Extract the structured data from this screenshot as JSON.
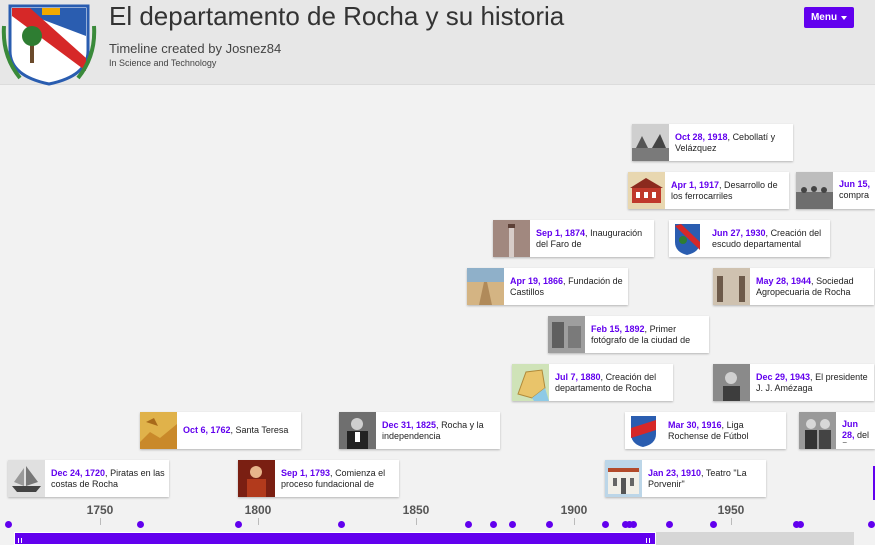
{
  "header": {
    "title": "El departamento de Rocha y su historia",
    "creator": "Timeline created by Josnez84",
    "category": "In Science and Technology",
    "menu_label": "Menu"
  },
  "events": [
    {
      "date": "Oct 28, 1918",
      "text": "Cebollatí y Velázquez",
      "thumb": "town-photo"
    },
    {
      "date": "Apr 1, 1917",
      "text": "Desarrollo de los ferrocarriles",
      "thumb": "station-photo"
    },
    {
      "date": "Jun 15,",
      "text": "compra e",
      "thumb": "crowd-photo"
    },
    {
      "date": "Sep 1, 1874",
      "text": "Inauguración del Faro de",
      "thumb": "lighthouse-photo"
    },
    {
      "date": "Jun 27, 1930",
      "text": "Creación del escudo departamental",
      "thumb": "coat-of-arms"
    },
    {
      "date": "Apr 19, 1866",
      "text": "Fundación de Castillos",
      "thumb": "street-photo"
    },
    {
      "date": "May 28, 1944",
      "text": "Sociedad Agropecuaria de Rocha",
      "thumb": "people-photo"
    },
    {
      "date": "Feb 15, 1892",
      "text": "Primer fotógrafo de la ciudad de",
      "thumb": "old-photo"
    },
    {
      "date": "Jul 7, 1880",
      "text": "Creación del departamento de Rocha",
      "thumb": "map-image"
    },
    {
      "date": "Dec 29, 1943",
      "text": "El presidente J. J. Amézaga",
      "thumb": "portrait-photo"
    },
    {
      "date": "Oct 6, 1762",
      "text": "Santa Teresa",
      "thumb": "fortress-image"
    },
    {
      "date": "Dec 31, 1825",
      "text": "Rocha y la independencia",
      "thumb": "officer-photo"
    },
    {
      "date": "Mar 30, 1916",
      "text": "Liga Rochense de Fútbol",
      "thumb": "league-logo"
    },
    {
      "date": "Jun 28,",
      "text": "del Rota",
      "thumb": "meeting-photo"
    },
    {
      "date": "Dec 24, 1720",
      "text": "Piratas en las costas de Rocha",
      "thumb": "ship-engraving"
    },
    {
      "date": "Sep 1, 1793",
      "text": "Comienza el proceso fundacional de",
      "thumb": "painting"
    },
    {
      "date": "Jan 23, 1910",
      "text": "Teatro \"La Porvenir\"",
      "thumb": "theater-photo"
    }
  ],
  "axis": {
    "ticks": [
      "1750",
      "1800",
      "1850",
      "1900",
      "1950"
    ]
  },
  "colors": {
    "accent": "#6200ee",
    "header_bg": "#e7e7e7",
    "page_bg": "#f2f2f2"
  }
}
